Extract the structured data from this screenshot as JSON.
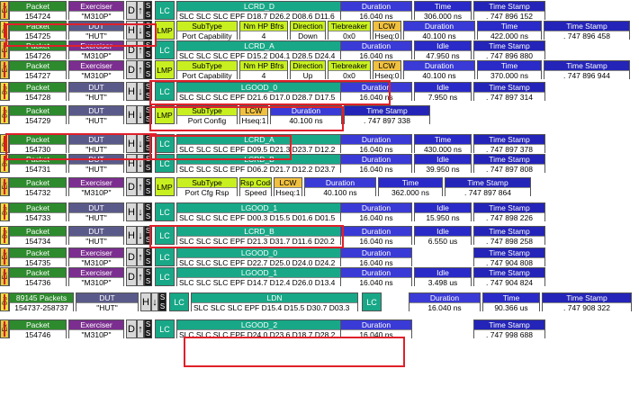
{
  "colors": {
    "packet": "#2d8a2d",
    "exerciser": "#7b2e8f",
    "dut": "#5a5a8a",
    "lc": "#18a887",
    "lmp": "#c8f020",
    "duration": "#3a3ad6",
    "highlight": "#e0202a"
  },
  "labels": {
    "packet": "Packet",
    "exerciser": "Exerciser",
    "dut": "DUT",
    "duration": "Duration",
    "time": "Time",
    "idle": "Idle",
    "timestamp": "Time Stamp",
    "subtype": "SubType",
    "nm_hp": "Nm HP Bfrs",
    "direction": "Direction",
    "tiebreaker": "Tiebreaker",
    "lcw": "LCW",
    "rsp_code": "Rsp Code",
    "lc": "LC",
    "lmp": "LMP",
    "dir_ex": "Ex",
    "dir_du": "Du",
    "h": "H",
    "d": "D",
    "q": "?",
    "s": "S"
  },
  "rows": [
    {
      "dir": "Ex",
      "packet": "154724",
      "src_label": "Exerciser",
      "src": "\"M310P\"",
      "ord": "LCRD_D",
      "syms": "SLC SLC SLC EPF D18.7 D26.2 D08.6 D11.6",
      "duration": "16.040 ns",
      "time": "306.000 ns",
      "timestamp": ". 747 896 152"
    },
    {
      "dir": "Du",
      "packet": "154725",
      "src_label": "DUT",
      "src": "\"HUT\"",
      "lmp_subtype": "Port Capability",
      "nmhp": "4",
      "direction": "Down",
      "tiebreaker": "0x0",
      "lcw": "Hseq:0",
      "duration": "40.100 ns",
      "time": "422.000 ns",
      "timestamp": ". 747 896 458"
    },
    {
      "dir": "Ex",
      "packet": "154726",
      "src_label": "Exerciser",
      "src": "\"M310P\"",
      "ord": "LCRD_A",
      "syms": "SLC SLC SLC EPF D15.2 D04.1 D28.5 D24.4",
      "duration": "16.040 ns",
      "idle": "47.950 ns",
      "timestamp": ". 747 896 880"
    },
    {
      "dir": "Ex",
      "packet": "154727",
      "src_label": "Exerciser",
      "src": "\"M310P\"",
      "lmp_subtype": "Port Capability",
      "nmhp": "4",
      "direction": "Up",
      "tiebreaker": "0x0",
      "lcw": "Hseq:0",
      "duration": "40.100 ns",
      "time": "370.000 ns",
      "timestamp": ". 747 896 944"
    },
    {
      "dir": "Du",
      "packet": "154728",
      "src_label": "DUT",
      "src": "\"HUT\"",
      "ord": "LGOOD_0",
      "syms": "SLC SLC SLC EPF D21.6 D17.0 D28.7 D17.5",
      "duration": "16.040 ns",
      "idle": "7.950 ns",
      "timestamp": ". 747 897 314"
    },
    {
      "dir": "Du",
      "packet": "154729",
      "src_label": "DUT",
      "src": "\"HUT\"",
      "lmp_subtype": "Port Config",
      "lcw": "Hseq:1",
      "duration": "40.100 ns",
      "timestamp": ". 747 897 338"
    },
    {
      "dir": "Du",
      "packet": "154730",
      "src_label": "DUT",
      "src": "\"HUT\"",
      "ord": "LCRD_A",
      "syms": "SLC SLC SLC EPF D09.5 D21.3 D23.7 D12.2",
      "duration": "16.040 ns",
      "time": "430.000 ns",
      "timestamp": ". 747 897 378"
    },
    {
      "dir": "Du",
      "packet": "154731",
      "src_label": "DUT",
      "src": "\"HUT\"",
      "ord": "LCRD_B",
      "syms": "SLC SLC SLC EPF D06.2 D21.7 D12.2 D23.7",
      "duration": "16.040 ns",
      "idle": "39.950 ns",
      "timestamp": ". 747 897 808"
    },
    {
      "dir": "Ex",
      "packet": "154732",
      "src_label": "Exerciser",
      "src": "\"M310P\"",
      "lmp_subtype": "Port Cfg Rsp",
      "rsp": "Speed",
      "lcw": "Hseq:1",
      "duration": "40.100 ns",
      "time": "362.000 ns",
      "timestamp": ". 747 897 864"
    },
    {
      "dir": "Du",
      "packet": "154733",
      "src_label": "DUT",
      "src": "\"HUT\"",
      "ord": "LGOOD_1",
      "syms": "SLC SLC SLC EPF D00.3 D15.5 D01.6 D01.5",
      "duration": "16.040 ns",
      "idle": "15.950 ns",
      "timestamp": ". 747 898 226"
    },
    {
      "dir": "Du",
      "packet": "154734",
      "src_label": "DUT",
      "src": "\"HUT\"",
      "ord": "LCRD_B",
      "syms": "SLC SLC SLC EPF D21.3 D31.7 D11.6 D20.2",
      "duration": "16.040 ns",
      "idle": "6.550 us",
      "timestamp": ". 747 898 258"
    },
    {
      "dir": "Ex",
      "packet": "154735",
      "src_label": "Exerciser",
      "src": "\"M310P\"",
      "ord": "LGOOD_0",
      "syms": "SLC SLC SLC EPF D22.7 D25.0 D24.0 D24.2",
      "duration": "16.040 ns",
      "timestamp": ". 747 904 808"
    },
    {
      "dir": "Ex",
      "packet": "154736",
      "src_label": "Exerciser",
      "src": "\"M310P\"",
      "ord": "LGOOD_1",
      "syms": "SLC SLC SLC EPF D14.7 D12.4 D26.0 D13.4",
      "duration": "16.040 ns",
      "idle": "3.498 us",
      "timestamp": ". 747 904 824"
    },
    {
      "dir": "Du",
      "packet": "89145 Packets",
      "packet_range": "154737-258737",
      "src_label": "DUT",
      "src": "\"HUT\"",
      "ord": "LDN",
      "syms": "SLC SLC SLC EPF D15.4 D15.5 D30.7 D03.3",
      "duration": "16.040 ns",
      "time": "90.366 us",
      "timestamp": ". 747 908 322"
    },
    {
      "dir": "Ex",
      "packet": "154746",
      "src_label": "Exerciser",
      "src": "\"M310P\"",
      "ord": "LGOOD_2",
      "syms": "SLC SLC SLC EPF D24.0 D23.6 D18.7 D28.2",
      "duration": "16.040 ns",
      "timestamp": ". 747 998 688"
    }
  ]
}
